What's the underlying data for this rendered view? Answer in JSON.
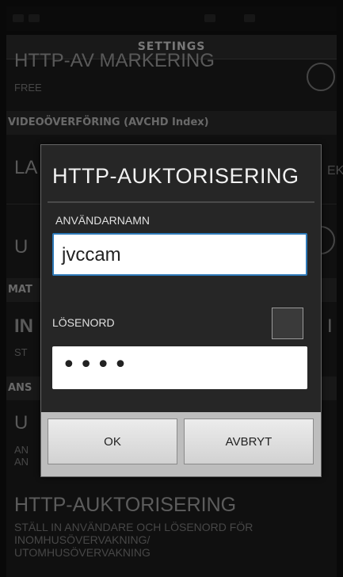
{
  "screen": {
    "title": "SETTINGS"
  },
  "background_list": {
    "item1": {
      "title": "HTTP-AV MARKERING",
      "sub": "FREE"
    },
    "section1": "VIDEOÖVERFÖRING (AVCHD Index)",
    "item2": {
      "title": "LA"
    },
    "item2_right": "EK",
    "item3": {
      "title": "U"
    },
    "section2": "MAT",
    "item4": {
      "title": "IN",
      "sub": "ST"
    },
    "item4_right": "I",
    "section3": "ANS",
    "item5": {
      "title": "U",
      "sub": "AN\nAN"
    },
    "item6": {
      "title": "HTTP-AUKTORISERING",
      "sub": "STÄLL IN ANVÄNDARE OCH LÖSENORD FÖR\nINOMHUSÖVERVAKNING/\nUTOMHUSÖVERVAKNING"
    }
  },
  "dialog": {
    "title": "HTTP-AUKTORISERING",
    "username_label": "ANVÄNDARNAMN",
    "username_value": "jvccam",
    "password_label": "LÖSENORD",
    "password_value": "••••",
    "ok_label": "OK",
    "cancel_label": "AVBRYT"
  },
  "colors": {
    "focus_border": "#2d79b8",
    "dialog_bg": "#262626",
    "button_bar": "#bdbdbd"
  }
}
